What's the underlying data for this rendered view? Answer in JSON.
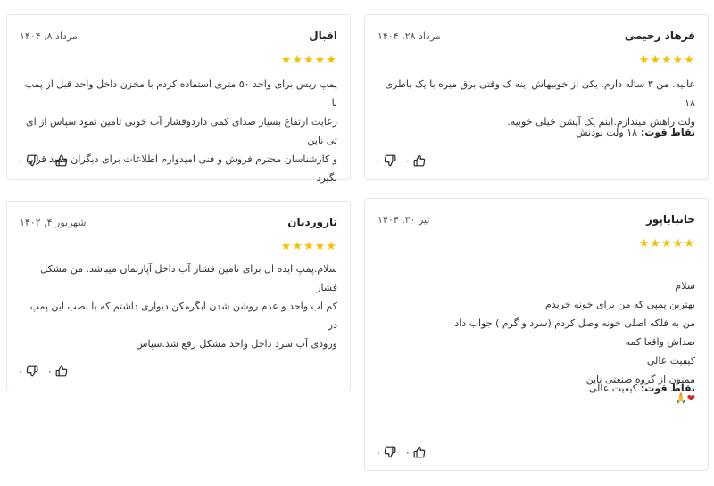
{
  "reviews": [
    {
      "author": "فرهاد رحیمی",
      "date": "مرداد ۲۸, ۱۴۰۴",
      "rating": 5,
      "stars": "★★★★★",
      "body": "عالیه. من ۳ ساله دارم. یکی از خوبیهاش اینه ک وقتی برق میره با یک باطری ۱۸\nولت راهش میندازم.اینم یک آپشن خیلی خوبیه.",
      "strength_label": "نقاط قوت:",
      "strength_value": "۱۸ ولت بودنش",
      "likes": "۰",
      "dislikes": "۰"
    },
    {
      "author": "اقبال",
      "date": "مرداد ۸, ۱۴۰۴",
      "rating": 5,
      "stars": "★★★★★",
      "body": "پمپ ریس برای واحد ۵۰ متری استفاده کردم با مخزن داخل واحد قبل از پمپ با\nرعایت ارتفاع بسیار صدای کمی داردوفشار آب خوبی تامین نمود سپاس از ای تی ناین\nو کارشناسان محترم فروش و فنی امیدوارم اطلاعات برای دیگران مفید قرار بگیرد",
      "likes": "۰",
      "dislikes": "۰"
    },
    {
      "author": "خانباباپور",
      "date": "تیر ۳۰, ۱۴۰۴",
      "rating": 5,
      "stars": "★★★★★",
      "body": "سلام\nبهترین پمپی که من برای خونه خریدم\nمن به فلکه اصلی خونه وصل کردم (سرد و گرم ) جواب داد\nصداش واقعا کمه\nکیفیت عالی\nممنون از گروه صنعتی ناین",
      "emoji_heart": "❤",
      "emoji_hands": "🙏",
      "strength_label": "نقاط قوت:",
      "strength_value": "کیفیت عالی",
      "likes": "۰",
      "dislikes": "۰"
    },
    {
      "author": "تاروردیان",
      "date": "شهریور ۴, ۱۴۰۲",
      "rating": 5,
      "stars": "★★★★★",
      "body": "سلام.پمپ ایده ال برای تامین فشار آب داخل آپارتمان میباشد. من مشکل فشار\nکم آب واحد و عدم روشن شدن آبگرمکن دیواری داشتم که با نصب این پمپ در\nورودی آب سرد داخل واحد مشکل رفع شد.سپاس",
      "likes": "۰",
      "dislikes": "۰"
    }
  ],
  "colors": {
    "star": "#f2c200",
    "border": "#e6e6e6",
    "heart": "#d62828"
  },
  "icons": {
    "like": "thumbs-up-icon",
    "dislike": "thumbs-down-icon",
    "star": "star-icon"
  }
}
